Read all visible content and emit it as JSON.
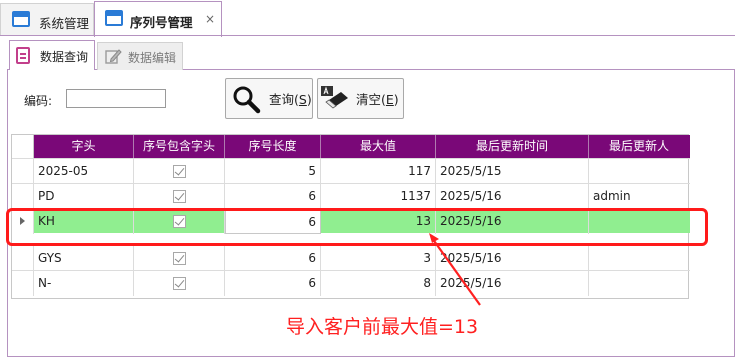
{
  "tabs": [
    {
      "label": "系统管理",
      "icon": "window-icon"
    },
    {
      "label": "序列号管理",
      "icon": "window-icon",
      "close": "×"
    }
  ],
  "subtabs": [
    {
      "label": "数据查询",
      "icon": "document-icon"
    },
    {
      "label": "数据编辑",
      "icon": "edit-icon"
    }
  ],
  "toolbar": {
    "code_label": "编码:",
    "code_value": "",
    "query_label": "查询(",
    "query_key": "S",
    "query_tail": ")",
    "clear_label": "清空(",
    "clear_key": "E",
    "clear_tail": ")"
  },
  "grid": {
    "columns": [
      "字头",
      "序号包含字头",
      "序号长度",
      "最大值",
      "最后更新时间",
      "最后更新人"
    ],
    "rows": [
      {
        "prefix": "2025-05",
        "include": true,
        "length": "5",
        "max": "117",
        "updated": "2025/5/15",
        "user": ""
      },
      {
        "prefix": "PD",
        "include": true,
        "length": "6",
        "max": "1137",
        "updated": "2025/5/16",
        "user": "admin"
      },
      {
        "prefix": "KH",
        "include": true,
        "length": "6",
        "max": "13",
        "updated": "2025/5/16",
        "user": ""
      },
      {
        "prefix": "GYS",
        "include": true,
        "length": "6",
        "max": "3",
        "updated": "2025/5/16",
        "user": ""
      },
      {
        "prefix": "N-",
        "include": true,
        "length": "6",
        "max": "8",
        "updated": "2025/5/16",
        "user": ""
      }
    ],
    "selected_row": 2
  },
  "annotation": "导入客户前最大值=13",
  "colors": {
    "header": "#7a0878",
    "selected_row": "#90ee90",
    "highlight": "#ff1a1a"
  }
}
